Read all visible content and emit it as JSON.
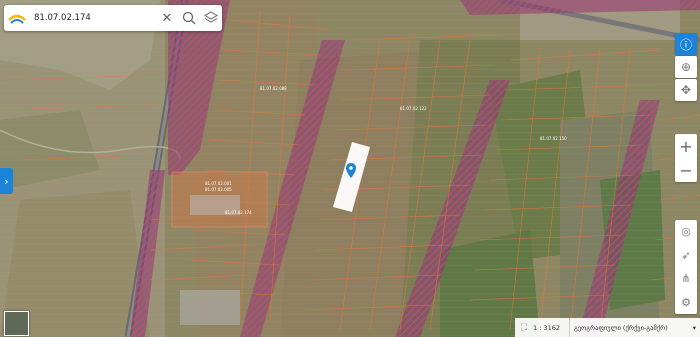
{
  "search": {
    "value": "81.07.02.174"
  },
  "icons": {
    "logo": "napr-logo-icon",
    "clear": "close-icon",
    "search": "search-icon",
    "layers": "layers-icon"
  },
  "scale": {
    "label": "1 : 3162"
  },
  "basemap": {
    "label": "გეოგრაფიული (ქრქვი-გამქრ)"
  },
  "parcel_labels": [
    {
      "text": "81.07.02.001"
    },
    {
      "text": "81.07.02.005"
    },
    {
      "text": "81.07.02.174"
    },
    {
      "text": "81.07.02.088"
    },
    {
      "text": "81.07.02.122"
    },
    {
      "text": "81.07.02.150"
    }
  ],
  "colors": {
    "accent": "#1c84d8",
    "parcel_line": "#e8753a",
    "restricted": "#a0306a",
    "selected": "#ffffff",
    "pin": "#1c84d8"
  }
}
